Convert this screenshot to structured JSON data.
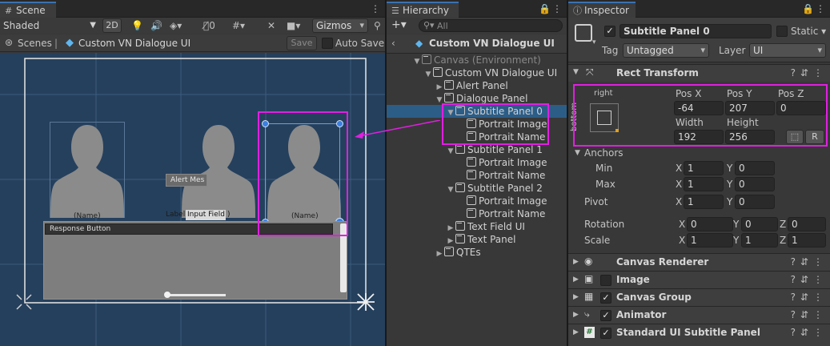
{
  "scene": {
    "tab": "Scene",
    "shading": "Shaded",
    "mode2d": "2D",
    "gizmo_count": "0",
    "gizmos": "Gizmos",
    "breadcrumb_root": "Scenes",
    "breadcrumb_item": "Custom VN Dialogue UI",
    "save": "Save",
    "autosave": "Auto Save",
    "portrait_names": [
      "(Name)",
      "(Name)",
      "(Name)"
    ],
    "alert_text": "Alert Mes",
    "label_text": "Label",
    "input_text": "Input Field",
    "input_suffix": ")",
    "response_text": "Response Button"
  },
  "hierarchy": {
    "tab": "Hierarchy",
    "search_placeholder": "All",
    "root": "Custom VN Dialogue UI",
    "items": [
      "Canvas (Environment)",
      "Custom VN Dialogue UI",
      "Alert Panel",
      "Dialogue Panel",
      "Subtitle Panel 0",
      "Portrait Image",
      "Portrait Name",
      "Subtitle Panel 1",
      "Portrait Image",
      "Portrait Name",
      "Subtitle Panel 2",
      "Portrait Image",
      "Portrait Name",
      "Text Field UI",
      "Text Panel",
      "QTEs"
    ]
  },
  "inspector": {
    "tab": "Inspector",
    "object_name": "Subtitle Panel 0",
    "static": "Static",
    "tag_label": "Tag",
    "tag": "Untagged",
    "layer_label": "Layer",
    "layer": "UI",
    "rect_transform": "Rect Transform",
    "anchor_h": "right",
    "anchor_v": "bottom",
    "pos_x_label": "Pos X",
    "pos_y_label": "Pos Y",
    "pos_z_label": "Pos Z",
    "pos_x": "-64",
    "pos_y": "207",
    "pos_z": "0",
    "width_label": "Width",
    "height_label": "Height",
    "width": "192",
    "height": "256",
    "r_button": "R",
    "anchors": "Anchors",
    "min": "Min",
    "max": "Max",
    "pivot": "Pivot",
    "rotation": "Rotation",
    "scale": "Scale",
    "x": "X",
    "y": "Y",
    "z": "Z",
    "min_x": "1",
    "min_y": "0",
    "max_x": "1",
    "max_y": "0",
    "pivot_x": "1",
    "pivot_y": "0",
    "rot_x": "0",
    "rot_y": "0",
    "rot_z": "0",
    "scale_x": "1",
    "scale_y": "1",
    "scale_z": "1",
    "components": [
      "Canvas Renderer",
      "Image",
      "Canvas Group",
      "Animator",
      "Standard UI Subtitle Panel"
    ]
  }
}
